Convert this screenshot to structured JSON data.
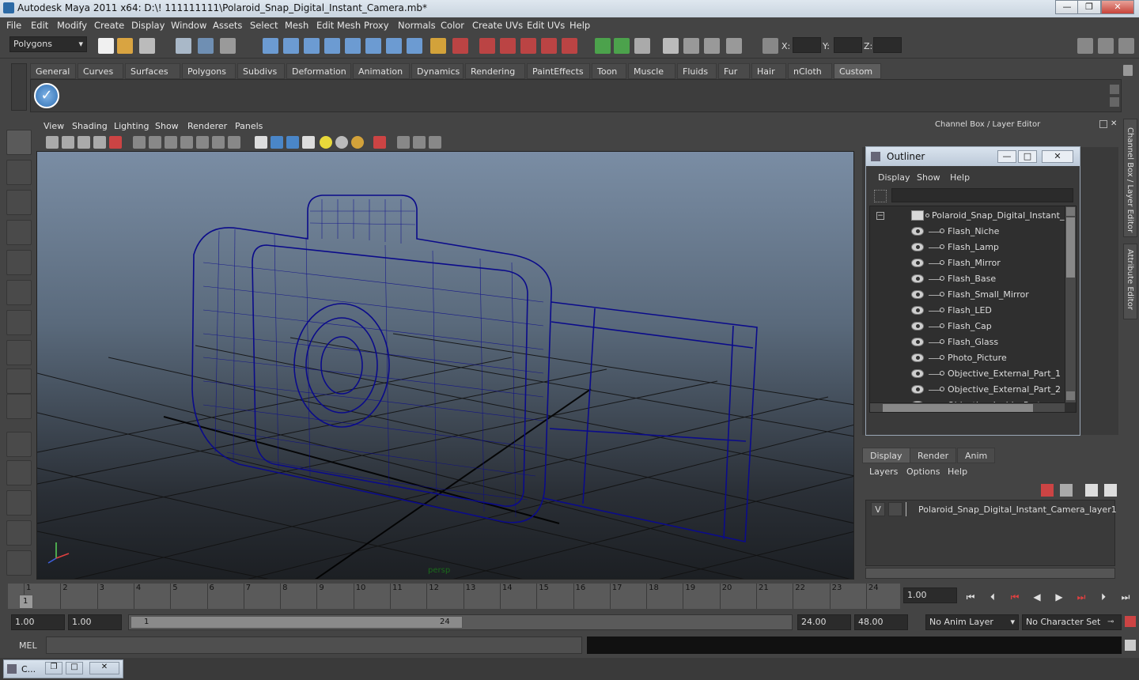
{
  "window": {
    "title": "Autodesk Maya 2011 x64: D:\\! 111111111\\Polaroid_Snap_Digital_Instant_Camera.mb*",
    "min_label": "—",
    "max_label": "❐",
    "close_label": "✕"
  },
  "menubar": [
    "File",
    "Edit",
    "Modify",
    "Create",
    "Display",
    "Window",
    "Assets",
    "Select",
    "Mesh",
    "Edit Mesh",
    "Proxy",
    "Normals",
    "Color",
    "Create UVs",
    "Edit UVs",
    "Help"
  ],
  "status": {
    "mode": "Polygons",
    "x_label": "X:",
    "y_label": "Y:",
    "z_label": "Z:"
  },
  "shelf_tabs": [
    "General",
    "Curves",
    "Surfaces",
    "Polygons",
    "Subdivs",
    "Deformation",
    "Animation",
    "Dynamics",
    "Rendering",
    "PaintEffects",
    "Toon",
    "Muscle",
    "Fluids",
    "Fur",
    "Hair",
    "nCloth",
    "Custom"
  ],
  "active_shelf_tab": "Custom",
  "viewport_menu": [
    "View",
    "Shading",
    "Lighting",
    "Show",
    "Renderer",
    "Panels"
  ],
  "viewport_label": "persp",
  "channel_box_title": "Channel Box / Layer Editor",
  "side_tabs": {
    "channel": "Channel Box / Layer Editor",
    "attribute": "Attribute Editor"
  },
  "outliner": {
    "title": "Outliner",
    "menu": [
      "Display",
      "Show",
      "Help"
    ],
    "root": "Polaroid_Snap_Digital_Instant_Car",
    "items": [
      "Flash_Niche",
      "Flash_Lamp",
      "Flash_Mirror",
      "Flash_Base",
      "Flash_Small_Mirror",
      "Flash_LED",
      "Flash_Cap",
      "Flash_Glass",
      "Photo_Picture",
      "Objective_External_Part_1",
      "Objective_External_Part_2",
      "Objective_Inside_Part"
    ]
  },
  "layer_editor": {
    "tabs": [
      "Display",
      "Render",
      "Anim"
    ],
    "active_tab": "Display",
    "menu": [
      "Layers",
      "Options",
      "Help"
    ],
    "layer_visible": "V",
    "layer_name": "Polaroid_Snap_Digital_Instant_Camera_layer1"
  },
  "timeline": {
    "frames": [
      "1",
      "2",
      "3",
      "4",
      "5",
      "6",
      "7",
      "8",
      "9",
      "10",
      "11",
      "12",
      "13",
      "14",
      "15",
      "16",
      "17",
      "18",
      "19",
      "20",
      "21",
      "22",
      "23",
      "24"
    ],
    "current_frame": "1",
    "current_time": "1.00"
  },
  "range": {
    "start": "1.00",
    "playback_start": "1.00",
    "slider_start": "1",
    "slider_end": "24",
    "playback_end": "24.00",
    "end": "48.00",
    "anim_layer": "No Anim Layer",
    "character_set": "No Character Set"
  },
  "cmdline": {
    "label": "MEL"
  },
  "taskbar": {
    "item": "C..."
  },
  "colors": {
    "wire": "#0b0b8a",
    "accent": "#5d7fa6"
  }
}
